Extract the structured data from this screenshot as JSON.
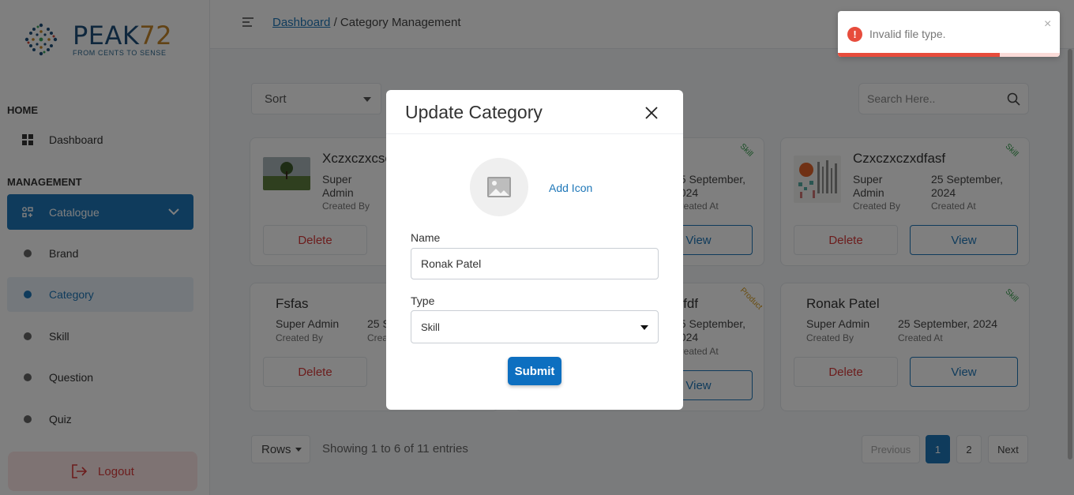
{
  "brand": {
    "name": "PEAK",
    "number": "72",
    "tagline": "FROM CENTS TO SENSE"
  },
  "sidebar": {
    "home_label": "HOME",
    "dashboard": "Dashboard",
    "management_label": "MANAGEMENT",
    "catalogue": "Catalogue",
    "sub_items": [
      {
        "label": "Brand"
      },
      {
        "label": "Category"
      },
      {
        "label": "Skill"
      },
      {
        "label": "Question"
      },
      {
        "label": "Quiz"
      }
    ],
    "logout": "Logout"
  },
  "header": {
    "breadcrumb_link": "Dashboard",
    "breadcrumb_sep": "/",
    "breadcrumb_current": "Category Management"
  },
  "toolbar": {
    "sort_label": "Sort",
    "search_placeholder": "Search Here.."
  },
  "cards": [
    {
      "title": "Xczxczxcsc",
      "creator": "Super Admin",
      "creator_label": "Created By",
      "date": "",
      "date_label": "",
      "badge": "",
      "delete": "Delete",
      "view": ""
    },
    {
      "title": "",
      "creator": "",
      "creator_label": "",
      "date": "25 September, 2024",
      "date_label": "Created At",
      "badge": "Skill",
      "delete": "",
      "view": "View"
    },
    {
      "title": "Czxczxczxdfasf",
      "creator": "Super Admin",
      "creator_label": "Created By",
      "date": "25 September, 2024",
      "date_label": "Created At",
      "badge": "Skill",
      "delete": "Delete",
      "view": "View"
    },
    {
      "title": "Fsfas",
      "creator": "Super Admin",
      "creator_label": "Created By",
      "date": "25 S",
      "date_label": "Crea",
      "badge": "",
      "delete": "Delete",
      "view": ""
    },
    {
      "title": "dfasfdf",
      "creator": "",
      "creator_label": "",
      "date": "25 September, 2024",
      "date_label": "Created At",
      "badge": "Product",
      "delete": "",
      "view": "View"
    },
    {
      "title": "Ronak Patel",
      "creator": "Super Admin",
      "creator_label": "Created By",
      "date": "25 September, 2024",
      "date_label": "Created At",
      "badge": "Skill",
      "delete": "Delete",
      "view": "View"
    }
  ],
  "footer": {
    "rows_label": "Rows",
    "showing": "Showing 1 to 6 of 11 entries",
    "prev": "Previous",
    "page1": "1",
    "page2": "2",
    "next": "Next"
  },
  "modal": {
    "title": "Update Category",
    "add_icon": "Add Icon",
    "name_label": "Name",
    "name_value": "Ronak Patel",
    "type_label": "Type",
    "type_value": "Skill",
    "submit": "Submit"
  },
  "toast": {
    "message": "Invalid file type.",
    "progress": 0.73
  },
  "colors": {
    "primary": "#1e77b8",
    "danger": "#d93a3a",
    "skill": "#2e9a47",
    "product": "#d59a1c"
  }
}
